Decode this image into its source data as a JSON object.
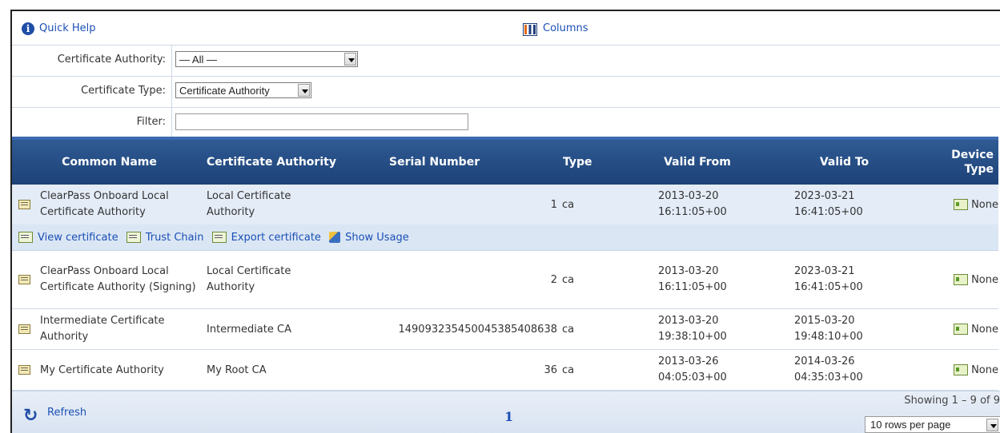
{
  "toolbar": {
    "quick_help": "Quick Help",
    "columns": "Columns"
  },
  "filters": {
    "ca_label": "Certificate Authority:",
    "ca_value": "— All —",
    "type_label": "Certificate Type:",
    "type_value": "Certificate Authority",
    "filter_label": "Filter:",
    "filter_value": ""
  },
  "table": {
    "headers": [
      "Common Name",
      "Certificate Authority",
      "Serial Number",
      "Type",
      "Valid From",
      "Valid To",
      "Device Type"
    ],
    "rows": [
      {
        "name": "ClearPass Onboard Local Certificate Authority",
        "ca": "Local Certificate Authority",
        "serial": "1",
        "type": "ca",
        "from": "2013-03-20 16:11:05+00",
        "to": "2023-03-21 16:41:05+00",
        "device": "None"
      },
      {
        "name": "ClearPass Onboard Local Certificate Authority (Signing)",
        "ca": "Local Certificate Authority",
        "serial": "2",
        "type": "ca",
        "from": "2013-03-20 16:11:05+00",
        "to": "2023-03-21 16:41:05+00",
        "device": "None"
      },
      {
        "name": "Intermediate Certificate Authority",
        "ca": "Intermediate CA",
        "serial": "14909323545004538540863​8",
        "type": "ca",
        "from": "2013-03-20 19:38:10+00",
        "to": "2015-03-20 19:48:10+00",
        "device": "None"
      },
      {
        "name": "My Certificate Authority",
        "ca": "My Root CA",
        "serial": "36",
        "type": "ca",
        "from": "2013-03-26 04:05:03+00",
        "to": "2014-03-26 04:35:03+00",
        "device": "None"
      }
    ],
    "actions": {
      "view": "View certificate",
      "trust": "Trust Chain",
      "export": "Export certificate",
      "usage": "Show Usage"
    }
  },
  "footer": {
    "refresh": "Refresh",
    "page": "1",
    "showing": "Showing 1 – 9 of 9",
    "rows_per_page": "10 rows per page"
  }
}
